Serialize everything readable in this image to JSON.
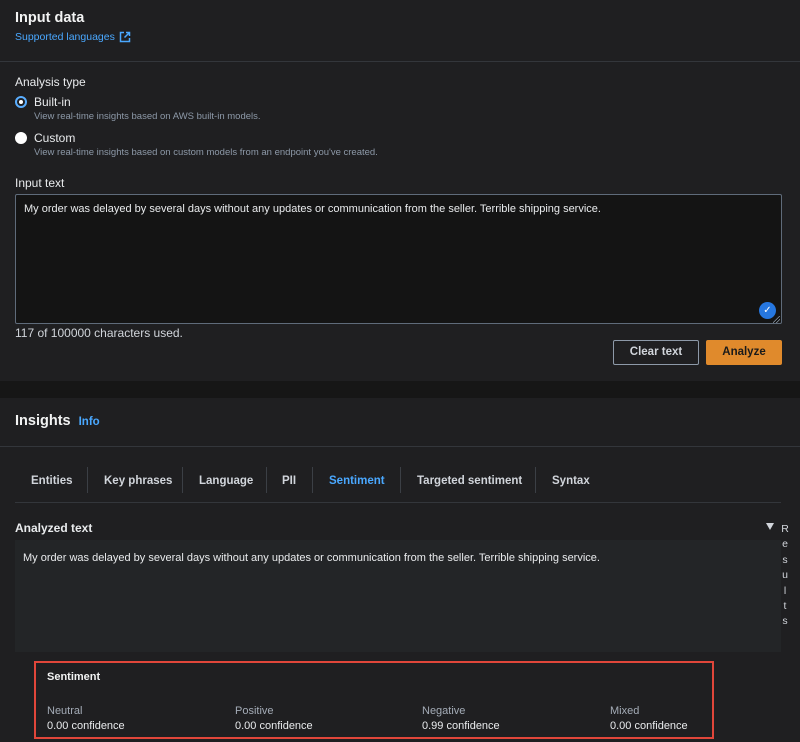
{
  "input_panel": {
    "title": "Input data",
    "supported_languages_link": "Supported languages",
    "analysis_type_label": "Analysis type",
    "options": [
      {
        "label": "Built-in",
        "description": "View real-time insights based on AWS built-in models.",
        "selected": true
      },
      {
        "label": "Custom",
        "description": "View real-time insights based on custom models from an endpoint you've created.",
        "selected": false
      }
    ],
    "input_text_label": "Input text",
    "input_text_value": "My order was delayed by several days without any updates or communication from the seller. Terrible shipping service.",
    "char_count": "117 of 100000 characters used.",
    "clear_button": "Clear text",
    "analyze_button": "Analyze"
  },
  "insights_panel": {
    "title": "Insights",
    "info_link": "Info",
    "tabs": [
      "Entities",
      "Key phrases",
      "Language",
      "PII",
      "Sentiment",
      "Targeted sentiment",
      "Syntax"
    ],
    "active_tab": "Sentiment",
    "analyzed_text_label": "Analyzed text",
    "analyzed_text_value": "My order was delayed by several days without any updates or communication from the seller. Terrible shipping service.",
    "results_label": [
      "R",
      "e",
      "s",
      "u",
      "l",
      "t",
      "s"
    ],
    "sentiment": {
      "title": "Sentiment",
      "items": [
        {
          "name": "Neutral",
          "confidence": "0.00 confidence"
        },
        {
          "name": "Positive",
          "confidence": "0.00 confidence"
        },
        {
          "name": "Negative",
          "confidence": "0.99 confidence"
        },
        {
          "name": "Mixed",
          "confidence": "0.00 confidence"
        }
      ]
    }
  },
  "colors": {
    "accent": "#4aa8ff",
    "primary_button": "#e08a2c",
    "highlight_border": "#e0463a"
  }
}
